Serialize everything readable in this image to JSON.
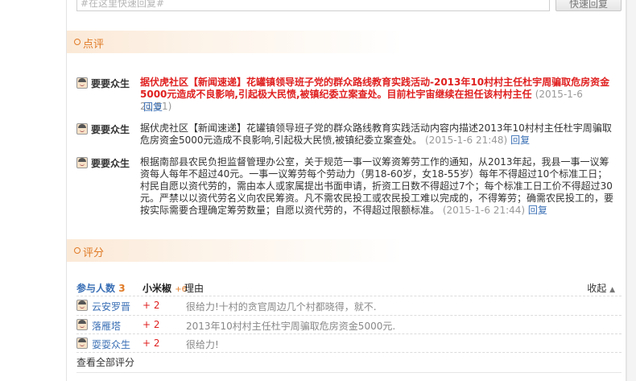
{
  "quick_reply": {
    "placeholder": "#在这里快速回复#",
    "button_label": "快速回复"
  },
  "comments_section": {
    "title": "点评",
    "items": [
      {
        "author": "要要众生",
        "text": "据伏虎社区【新闻速递】花罐镇领导班子党的群众路线教育实践活动-2013年10村村主任杜宇周骗取危房资金5000元造成不良影响,引起极大民愤,被镇纪委立案查处。目前杜宇宙继续在担任该村村主任",
        "time": "(2015-1-6 21:51)",
        "reply_label": "回复",
        "highlighted": true
      },
      {
        "author": "要要众生",
        "text": "据伏虎社区【新闻速递】花罐镇领导班子党的群众路线教育实践活动内容内描述2013年10村村主任杜宇周骗取危房资金5000元造成不良影响,引起极大民愤,被镇纪委立案查处。",
        "time": "(2015-1-6 21:48)",
        "reply_label": "回复",
        "highlighted": false
      },
      {
        "author": "要要众生",
        "text": "根据南部县农民负担监督管理办公室，关于规范一事一议筹资筹劳工作的通知，从2013年起，我县一事一议筹资每人每年不超过40元。一事一议筹劳每个劳动力（男18-60岁，女18-55岁）每年不得超过10个标准工日；村民自愿以资代劳的，需由本人或家属提出书面申请，折资工日数不得超过7个；每个标准工日工价不得超过30元。严禁以以资代劳名义向农民筹资。凡不需农民投工或农民投工难以完成的，不得筹劳；确需农民投工的，要按实际需要合理确定筹劳数量；自愿以资代劳的，不得超过限额标准。",
        "time": "(2015-1-6 21:44)",
        "reply_label": "回复",
        "highlighted": false
      }
    ]
  },
  "rating_section": {
    "title": "评分",
    "header": {
      "participants_label": "参与人数",
      "participants_count": "3",
      "currency_label": "小米椒",
      "currency_total": "+6",
      "reason_label": "理由",
      "collapse_label": "收起",
      "collapse_arrow": "▲"
    },
    "rows": [
      {
        "name": "云安罗晋",
        "score": "+ 2",
        "reason": "很给力!十村的贪官周边几个村都晓得，就不."
      },
      {
        "name": "落雁塔",
        "score": "+ 2",
        "reason": "2013年10村村主任杜宇周骗取危房资金5000元."
      },
      {
        "name": "耍耍众生",
        "score": "+ 2",
        "reason": "很给力!"
      }
    ],
    "view_all_label": "查看全部评分"
  },
  "colors": {
    "accent": "#e07b27",
    "link": "#3a6fb5",
    "highlight_text": "#e02020",
    "muted": "#999999"
  }
}
